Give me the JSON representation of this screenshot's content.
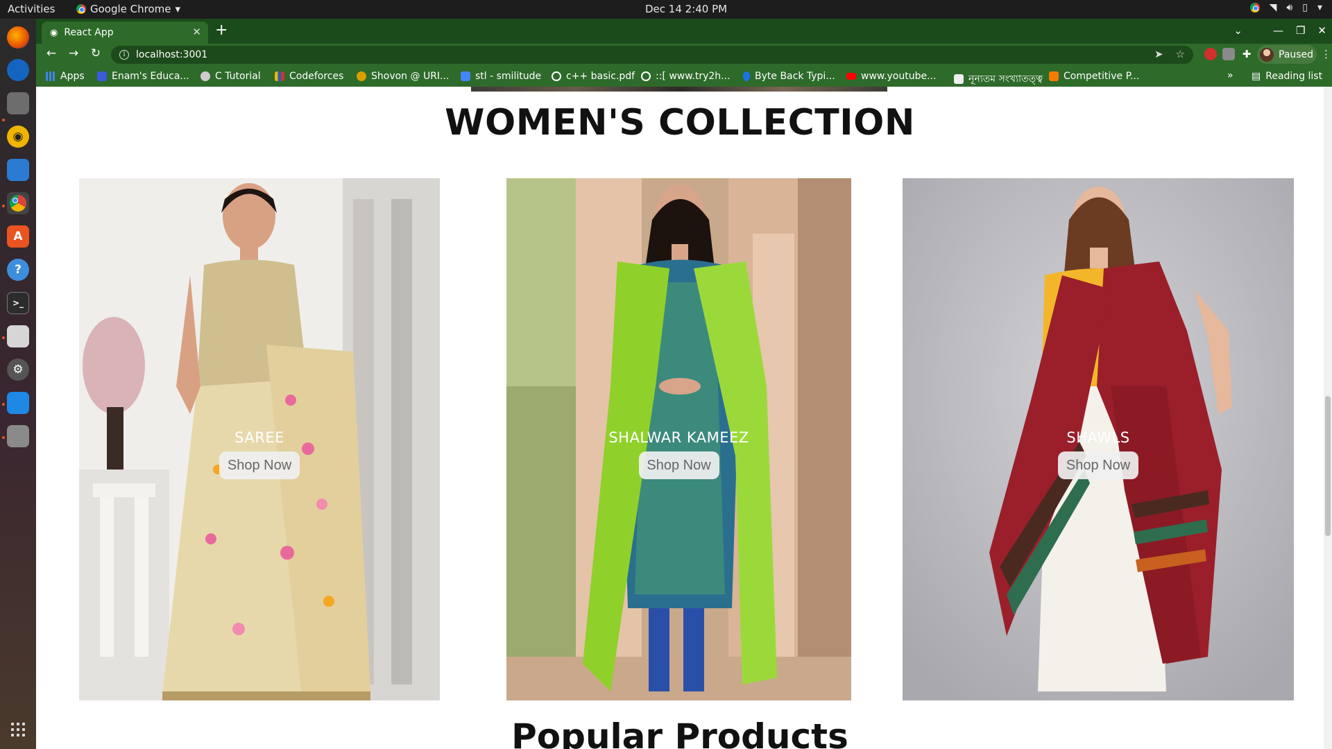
{
  "system": {
    "activities": "Activities",
    "app_menu": "Google Chrome",
    "clock": "Dec 14  2:40 PM"
  },
  "browser": {
    "tab_title": "React App",
    "url": "localhost:3001",
    "profile_label": "Paused",
    "bookmarks": [
      {
        "label": "Apps",
        "color": "#4285f4"
      },
      {
        "label": "Enam's Educa...",
        "color": "#3b5bdb"
      },
      {
        "label": "C Tutorial",
        "color": "#cccccc"
      },
      {
        "label": "Codeforces",
        "color": "#f5b400"
      },
      {
        "label": "Shovon @ URI...",
        "color": "#d9a000"
      },
      {
        "label": "stl - smilitude",
        "color": "#4285f4"
      },
      {
        "label": "c++ basic.pdf",
        "color": "#ffffff"
      },
      {
        "label": "::[ www.try2h...",
        "color": "#ffffff"
      },
      {
        "label": "Byte Back Typi...",
        "color": "#1a73e8"
      },
      {
        "label": "www.youtube...",
        "color": "#ff0000"
      },
      {
        "label": "নূন্যতম সংখ্যাতত্ত্ব",
        "color": "#eeeeee"
      },
      {
        "label": "Competitive P...",
        "color": "#f57c00"
      }
    ],
    "reading_list": "Reading list"
  },
  "page": {
    "collection_title": "WOMEN'S COLLECTION",
    "cards": [
      {
        "label": "SAREE",
        "button": "Shop Now"
      },
      {
        "label": "SHALWAR KAMEEZ",
        "button": "Shop Now"
      },
      {
        "label": "SHAWLS",
        "button": "Shop Now"
      }
    ],
    "popular_title": "Popular Products"
  }
}
